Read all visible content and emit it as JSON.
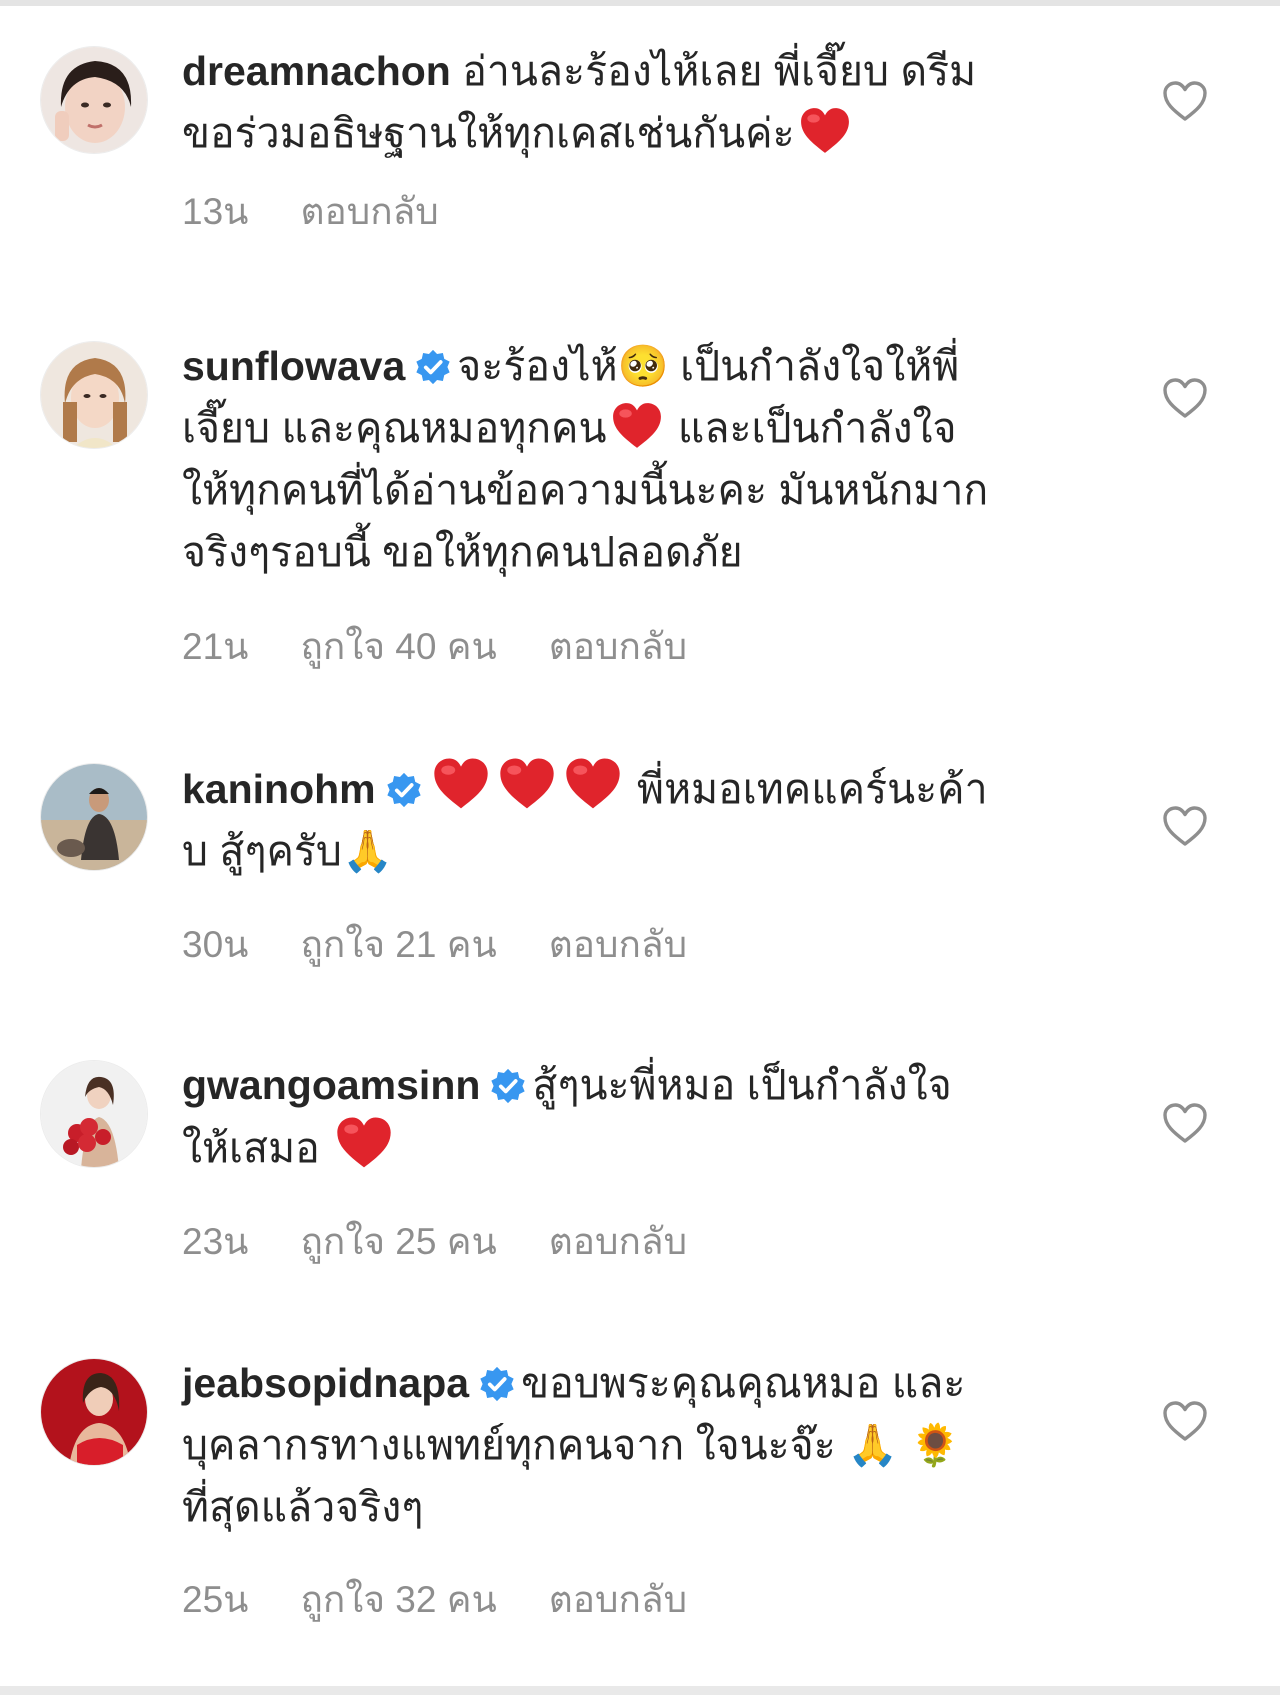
{
  "comments": [
    {
      "username": "dreamnachon",
      "verified": false,
      "lines": [
        "อ่านละร้องไห้เลย พี่เจี๊ยบ ดรีม",
        "ขอร่วมอธิษฐานให้ทุกเคสเช่นกันค่ะ"
      ],
      "time": "13น",
      "likes": "",
      "reply": "ตอบกลับ"
    },
    {
      "username": "sunflowava",
      "verified": true,
      "lines": [
        "จะร้องไห้",
        "เป็นกำลังใจให้พี่",
        "เจี๊ยบ และคุณหมอทุกคน",
        "และเป็นกำลังใจ",
        "ให้ทุกคนที่ได้อ่านข้อความนี้นะคะ มันหนักมาก",
        "จริงๆรอบนี้ ขอให้ทุกคนปลอดภัย"
      ],
      "emoji_pleading": "🥺",
      "time": "21น",
      "likes": "ถูกใจ 40 คน",
      "reply": "ตอบกลับ"
    },
    {
      "username": "kaninohm",
      "verified": true,
      "lines": [
        "พี่หมอเทคแคร์นะค้า",
        "บ สู้ๆครับ"
      ],
      "emoji_pray": "🙏",
      "time": "30น",
      "likes": "ถูกใจ 21 คน",
      "reply": "ตอบกลับ"
    },
    {
      "username": "gwangoamsinn",
      "verified": true,
      "lines": [
        "สู้ๆนะพี่หมอ เป็นกำลังใจ",
        "ให้เสมอ"
      ],
      "time": "23น",
      "likes": "ถูกใจ 25 คน",
      "reply": "ตอบกลับ"
    },
    {
      "username": "jeabsopidnapa",
      "verified": true,
      "lines": [
        "ขอบพระคุณคุณหมอ และ",
        "บุคลากรทางแพทย์ทุกคนจาก ใจนะจ๊ะ",
        "ที่สุดแล้วจริงๆ"
      ],
      "emoji_pray": "🙏",
      "emoji_sunflower": "🌻",
      "time": "25น",
      "likes": "ถูกใจ 32 คน",
      "reply": "ตอบกลับ"
    }
  ],
  "colors": {
    "text": "#262626",
    "meta": "#8e8e8e",
    "verified": "#3897f0",
    "heart_emoji": "#e0242c",
    "like_icon": "#8e8e8e"
  },
  "icons": {
    "like": "heart-outline-icon",
    "verified": "verified-badge-icon",
    "red_heart": "red-heart-emoji-icon"
  }
}
